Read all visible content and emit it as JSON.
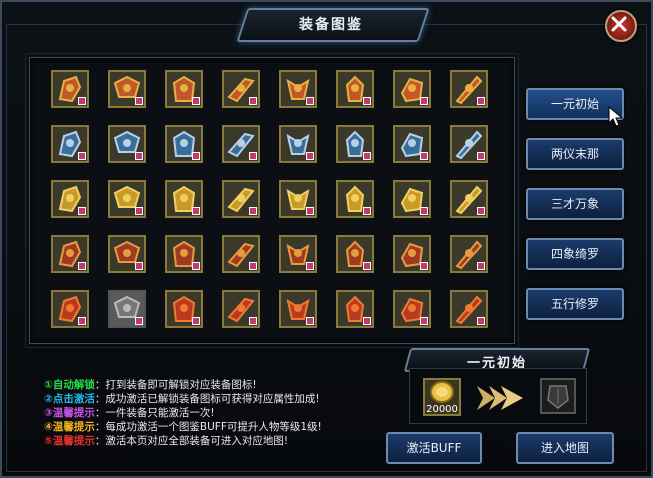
{
  "window": {
    "title": "装备图鉴"
  },
  "grid": {
    "rows": 5,
    "cols": 8,
    "gray_slots": [
      [
        4,
        1
      ]
    ],
    "slot_icon": "equipment-icon",
    "badge_color": "#c43a6e"
  },
  "stages": [
    {
      "label": "一元初始",
      "active": true
    },
    {
      "label": "两仪末那",
      "active": false
    },
    {
      "label": "三才万象",
      "active": false
    },
    {
      "label": "四象绮罗",
      "active": false
    },
    {
      "label": "五行修罗",
      "active": false
    }
  ],
  "info": [
    {
      "tag": "①自动解锁",
      "sep": "：",
      "text": "打到装备即可解锁对应装备图标!",
      "color": "#28d84a"
    },
    {
      "tag": "②点击激活",
      "sep": "：",
      "text": "成功激活已解锁装备图标可获得对应属性加成!",
      "color": "#22b8e8"
    },
    {
      "tag": "③温馨提示",
      "sep": "：",
      "text": "一件装备只能激活一次!",
      "color": "#c652e8"
    },
    {
      "tag": "④温馨提示",
      "sep": "：",
      "text": "每成功激活一个图鉴BUFF可提升人物等级1级!",
      "color": "#f0b020"
    },
    {
      "tag": "⑤温馨提示",
      "sep": "：",
      "text": "激活本页对应全部装备可进入对应地图!",
      "color": "#e8302a"
    }
  ],
  "activation": {
    "title": "一元初始",
    "cost": "20000",
    "coin_icon": "gold-coin-icon",
    "arrow_icon": "arrow-right-icon",
    "result_icon": "locked-armor-icon"
  },
  "buttons": {
    "activate": "激活BUFF",
    "enter_map": "进入地图"
  },
  "colors": {
    "accent": "#6c89ae",
    "frame": "#3b4a5c",
    "slot_border": "#8a7a3a"
  }
}
